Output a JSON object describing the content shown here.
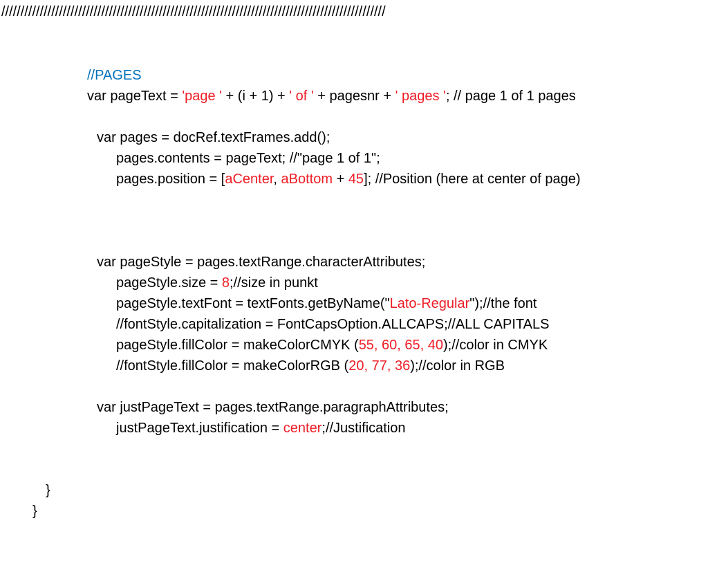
{
  "slashes": "////////////////////////////////////////////////////////////////////////////////////////////////////",
  "c1": "//PAGES",
  "l2a": "var pageText = ",
  "l2b": "'page '",
  "l2c": " + (i + 1) + ",
  "l2d": "' of '",
  "l2e": " + pagesnr + ",
  "l2f": "' pages '",
  "l2g": "; // page 1 of 1 pages",
  "l3": "var pages = docRef.textFrames.add();",
  "l4": "pages.contents = pageText; //\"page 1 of 1\";",
  "l5a": "pages.position = [",
  "l5b": "aCenter",
  "l5c": ", ",
  "l5d": "aBottom",
  "l5e": " + ",
  "l5f": "45",
  "l5g": "]; //Position (here at center of page)",
  "l6": "var pageStyle = pages.textRange.characterAttributes;",
  "l7a": "pageStyle.size = ",
  "l7b": "8",
  "l7c": ";//size in punkt",
  "l8a": "pageStyle.textFont = textFonts.getByName(\"",
  "l8b": "Lato-Regular",
  "l8c": "\");//the font",
  "l9": "//fontStyle.capitalization = FontCapsOption.ALLCAPS;//ALL CAPITALS",
  "l10a": "pageStyle.fillColor = makeColorCMYK (",
  "l10b": "55, 60, 65, 40",
  "l10c": ");//color in CMYK",
  "l11a": "//fontStyle.fillColor = makeColorRGB (",
  "l11b": "20, 77, 36",
  "l11c": ");//color in RGB",
  "l12": "var justPageText = pages.textRange.paragraphAttributes;",
  "l13a": "justPageText.justification = ",
  "l13b": "center",
  "l13c": ";//Justification",
  "braceA": "}",
  "braceB": "}"
}
